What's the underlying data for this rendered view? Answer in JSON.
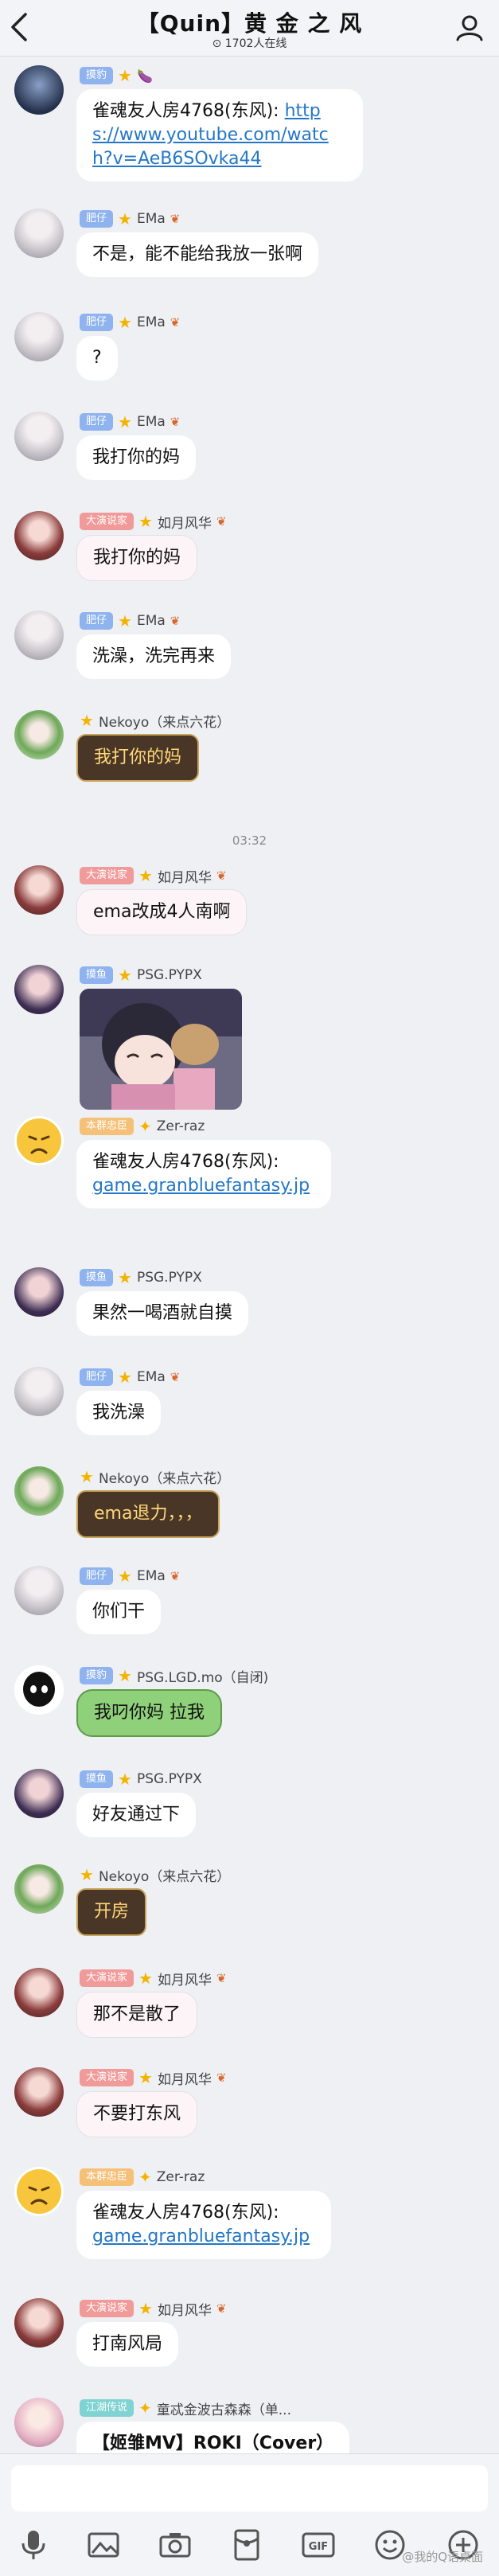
{
  "header": {
    "title": "【Quin】黄 金 之 风",
    "online": "1702人在线"
  },
  "timestamp": "03:32",
  "messages": [
    {
      "badge": "摸豹",
      "sender": "",
      "extra": "🍆",
      "text": "雀魂友人房4768(东风):",
      "link": "https://www.youtube.com/watch?v=AeB6SOvka44"
    },
    {
      "badge": "肥仔",
      "sender": "EMa",
      "text": "不是，能不能给我放一张啊"
    },
    {
      "badge": "肥仔",
      "sender": "EMa",
      "text": "?"
    },
    {
      "badge": "肥仔",
      "sender": "EMa",
      "text": "我打你的妈"
    },
    {
      "badge": "大演说家",
      "sender": "如月风华",
      "text": "我打你的妈"
    },
    {
      "badge": "肥仔",
      "sender": "EMa",
      "text": "洗澡，洗完再来"
    },
    {
      "badge": "",
      "sender": "Nekoyo（来点六花）",
      "text": "我打你的妈"
    },
    {
      "badge": "大演说家",
      "sender": "如月风华",
      "text": "ema改成4人南啊"
    },
    {
      "badge": "摸鱼",
      "sender": "PSG.PYPX",
      "text": ""
    },
    {
      "badge": "本群忠臣",
      "sender": "Zer-raz",
      "text": "雀魂友人房4768(东风):",
      "link": "game.granbluefantasy.jp"
    },
    {
      "badge": "摸鱼",
      "sender": "PSG.PYPX",
      "text": "果然一喝酒就自摸"
    },
    {
      "badge": "肥仔",
      "sender": "EMa",
      "text": "我洗澡"
    },
    {
      "badge": "",
      "sender": "Nekoyo（来点六花）",
      "text": "ema退力，，，"
    },
    {
      "badge": "肥仔",
      "sender": "EMa",
      "text": "你们干"
    },
    {
      "badge": "摸豹",
      "sender": "PSG.LGD.mo（自闭)",
      "text": "我叼你妈  拉我"
    },
    {
      "badge": "摸鱼",
      "sender": "PSG.PYPX",
      "text": "好友通过下"
    },
    {
      "badge": "",
      "sender": "Nekoyo（来点六花）",
      "text": "开房"
    },
    {
      "badge": "大演说家",
      "sender": "如月风华",
      "text": "那不是散了"
    },
    {
      "badge": "大演说家",
      "sender": "如月风华",
      "text": "不要打东风"
    },
    {
      "badge": "本群忠臣",
      "sender": "Zer-raz",
      "text": "雀魂友人房4768(东风):",
      "link": "game.granbluefantasy.jp"
    },
    {
      "badge": "大演说家",
      "sender": "如月风华",
      "text": "打南风局"
    },
    {
      "badge": "江湖传说",
      "sender": "童忒金波古森森（单...",
      "text": "【姬雏MV】ROKI（Cover）"
    }
  ],
  "watermark": "@我的Q语桌面",
  "icons": {
    "back": "chevron-left-icon",
    "profile": "person-icon",
    "mic": "mic-icon",
    "image": "image-icon",
    "camera": "camera-icon",
    "redpacket": "red-packet-icon",
    "gif": "gif-icon",
    "emoji": "emoji-icon",
    "plus": "plus-icon"
  },
  "colors": {
    "link": "#2477c6",
    "star": "#f5b301",
    "badge_blue": "#8fb3ee",
    "badge_red": "#f19a9a"
  }
}
